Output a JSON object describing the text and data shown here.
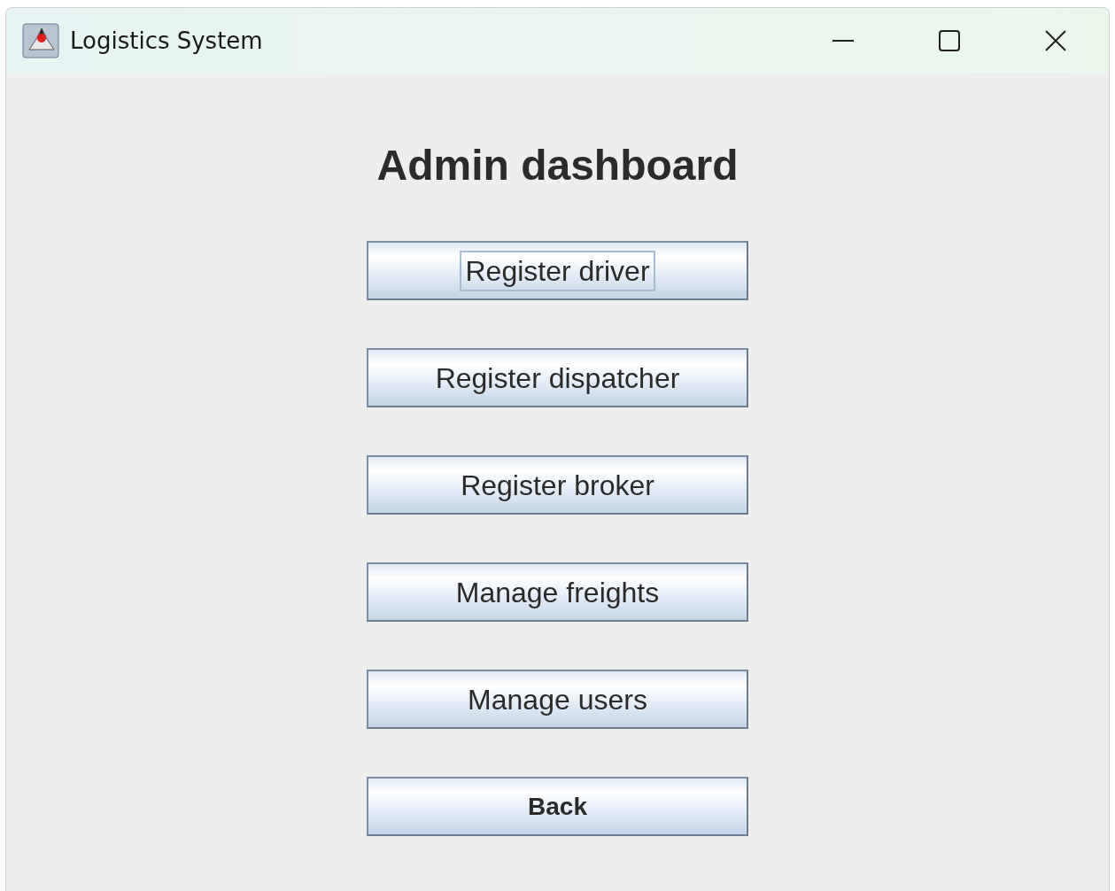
{
  "window": {
    "title": "Logistics System"
  },
  "heading": "Admin dashboard",
  "buttons": [
    {
      "label": "Register driver",
      "focused": true,
      "bold": false
    },
    {
      "label": "Register dispatcher",
      "focused": false,
      "bold": false
    },
    {
      "label": "Register broker",
      "focused": false,
      "bold": false
    },
    {
      "label": "Manage freights",
      "focused": false,
      "bold": false
    },
    {
      "label": "Manage users",
      "focused": false,
      "bold": false
    },
    {
      "label": "Back",
      "focused": false,
      "bold": true
    }
  ]
}
